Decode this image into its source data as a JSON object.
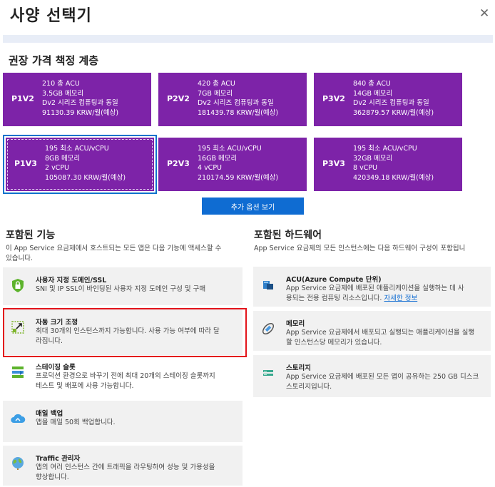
{
  "title": "사양 선택기",
  "close_glyph": "✕",
  "recommended": {
    "heading": "권장 가격 책정 계층",
    "tiers": [
      {
        "code": "P1V2",
        "lines": [
          "210 총 ACU",
          "3.5GB 메모리",
          "Dv2 시리즈 컴퓨팅과 동일",
          "91130.39 KRW/월(예상)"
        ]
      },
      {
        "code": "P2V2",
        "lines": [
          "420 총 ACU",
          "7GB 메모리",
          "Dv2 시리즈 컴퓨팅과 동일",
          "181439.78 KRW/월(예상)"
        ]
      },
      {
        "code": "P3V2",
        "lines": [
          "840 총 ACU",
          "14GB 메모리",
          "Dv2 시리즈 컴퓨팅과 동일",
          "362879.57 KRW/월(예상)"
        ]
      },
      {
        "code": "P1V3",
        "lines": [
          "195 최소 ACU/vCPU",
          "8GB 메모리",
          "2 vCPU",
          "105087.30 KRW/월(예상)"
        ],
        "selected": true
      },
      {
        "code": "P2V3",
        "lines": [
          "195 최소 ACU/vCPU",
          "16GB 메모리",
          "4 vCPU",
          "210174.59 KRW/월(예상)"
        ]
      },
      {
        "code": "P3V3",
        "lines": [
          "195 최소 ACU/vCPU",
          "32GB 메모리",
          "8 vCPU",
          "420349.18 KRW/월(예상)"
        ]
      }
    ],
    "more_options_label": "추가 옵션 보기"
  },
  "features": {
    "heading": "포함된 기능",
    "description": [
      "이 App Service 요금제에서 호스트되는 모든 앱은 다음 기능에 액세스할 수",
      "있습니다."
    ],
    "items": [
      {
        "title": "사용자 지정 도메인/SSL",
        "desc": [
          "SNI 및 IP SSL이 바인딩된 사용자 지정 도메인 구성 및 구매"
        ],
        "icon": "lock-icon"
      },
      {
        "title": "자동 크기 조정",
        "desc": [
          "최대 30개의 인스턴스까지 가능합니다. 사용 가능 여부에 따라 달",
          "라집니다."
        ],
        "icon": "autoscale-icon"
      },
      {
        "title": "스테이징 슬롯",
        "desc": [
          "프로덕션 환경으로 바꾸기 전에 최대 20개의 스테이징 슬롯까지",
          "테스트 및 배포에 사용 가능합니다."
        ],
        "icon": "staging-slot-icon"
      },
      {
        "title": "매일 백업",
        "desc": [
          "앱을 매일 50회 백업합니다."
        ],
        "icon": "cloud-backup-icon"
      },
      {
        "title": "Traffic 관리자",
        "desc": [
          "앱의 여러 인스턴스 간에 트래픽을 라우팅하여 성능 및 가용성을",
          "향상합니다."
        ],
        "icon": "globe-icon"
      }
    ]
  },
  "hardware": {
    "heading": "포함된 하드웨어",
    "description": [
      "App Service 요금제의 모든 인스턴스에는 다음 하드웨어 구성이 포함됩니"
    ],
    "items": [
      {
        "title": "ACU(Azure Compute 단위)",
        "desc": [
          "App Service 요금제에 배포된 애플리케이션을 실행하는 데 사",
          "용되는 전용 컴퓨팅 리소스입니다."
        ],
        "link": "자세한 정보",
        "icon": "compute-icon"
      },
      {
        "title": "메모리",
        "desc": [
          "App Service 요금제에서 배포되고 실행되는 애플리케이션을 실행",
          "할 인스턴스당 메모리가 있습니다."
        ],
        "icon": "memory-icon"
      },
      {
        "title": "스토리지",
        "desc": [
          "App Service 요금제에 배포된 모든 앱이 공유하는 250 GB 디스크",
          "스토리지입니다."
        ],
        "icon": "storage-icon"
      }
    ]
  },
  "colors": {
    "tier_purple": "#7d23a8",
    "primary_blue": "#0f6cd2",
    "highlight_red": "#e3141b"
  }
}
